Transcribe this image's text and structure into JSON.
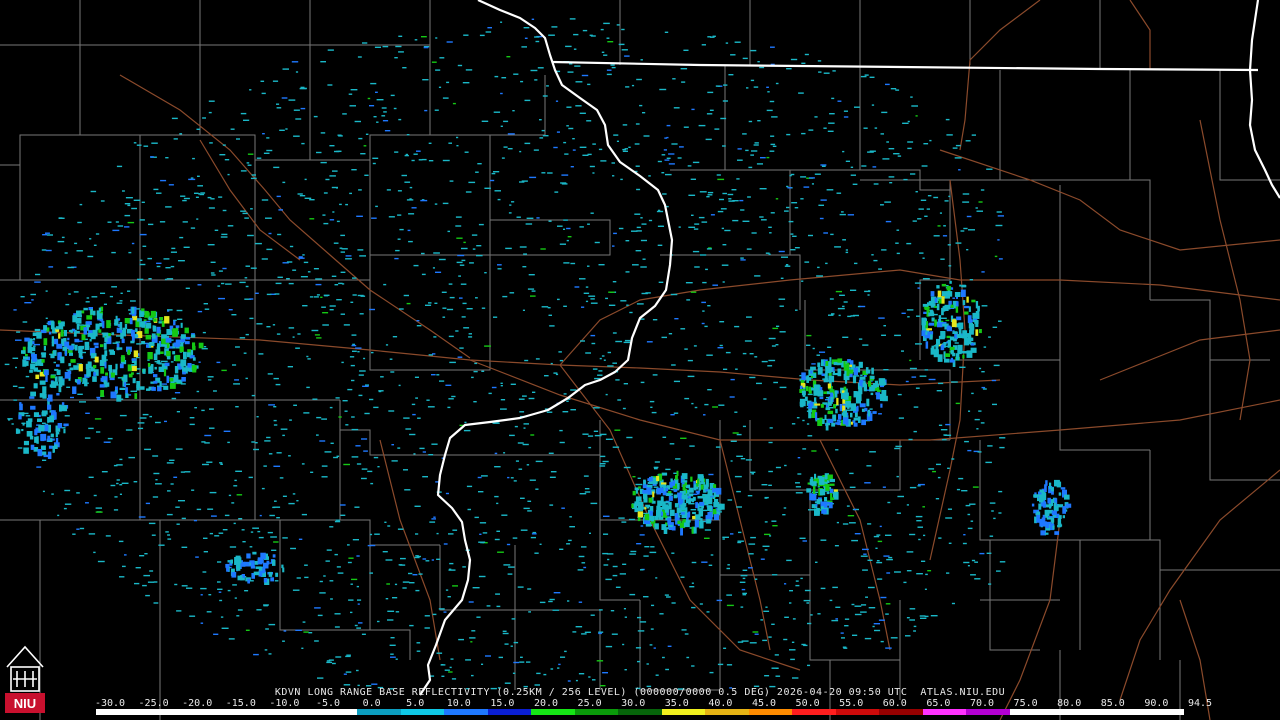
{
  "header": {
    "product_line": "KDVN LONG RANGE BASE REFLECTIVITY (0.25KM / 256 LEVEL) (000000/0000 0.5 DEG) 2026-04-20 09:50 UTC  ATLAS.NIU.EDU"
  },
  "logo": {
    "text": "NIU",
    "icon": "university-tower-icon",
    "accent": "#c8102e"
  },
  "colorbar": {
    "labels": [
      "-30.0",
      "-25.0",
      "-20.0",
      "-15.0",
      "-10.0",
      "-5.0",
      "0.0",
      "5.0",
      "10.0",
      "15.0",
      "20.0",
      "25.0",
      "30.0",
      "35.0",
      "40.0",
      "45.0",
      "50.0",
      "55.0",
      "60.0",
      "65.0",
      "70.0",
      "75.0",
      "80.0",
      "85.0",
      "90.0",
      "94.5"
    ],
    "colors": [
      "#ffffff",
      "#ffffff",
      "#ffffff",
      "#ffffff",
      "#ffffff",
      "#ffffff",
      "#0c9ec0",
      "#0fc8e6",
      "#1e78ff",
      "#0a1ed2",
      "#15e615",
      "#0a9b0a",
      "#06640a",
      "#f0f01e",
      "#e6b414",
      "#ff8c00",
      "#ff1e1e",
      "#cd0a0a",
      "#960000",
      "#ff32ff",
      "#b400d2",
      "#ffffff",
      "#ffffff",
      "#ffffff",
      "#ffffff"
    ]
  },
  "map": {
    "radar_site": "KDVN",
    "colors": {
      "state_border": "#ffffff",
      "county_line": "#8c8c8c",
      "highway": "#8b4a2b",
      "echo_light": "#1ab8c8",
      "echo_mid": "#1e78ff",
      "echo_heavy": "#15c815",
      "echo_peak": "#e6e61e"
    }
  }
}
